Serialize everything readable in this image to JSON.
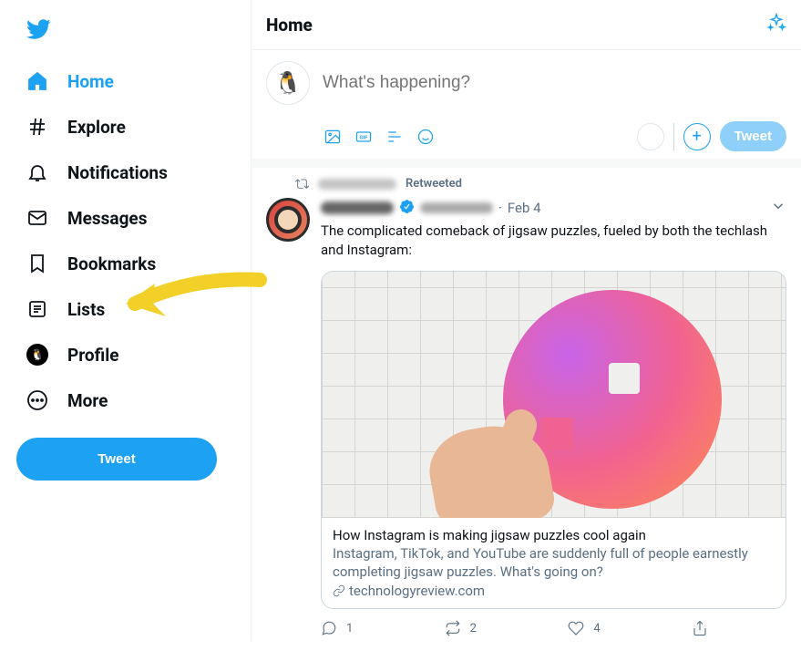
{
  "sidebar": {
    "items": [
      {
        "label": "Home",
        "active": true,
        "icon": "home"
      },
      {
        "label": "Explore",
        "active": false,
        "icon": "hash"
      },
      {
        "label": "Notifications",
        "active": false,
        "icon": "bell"
      },
      {
        "label": "Messages",
        "active": false,
        "icon": "mail"
      },
      {
        "label": "Bookmarks",
        "active": false,
        "icon": "bookmark"
      },
      {
        "label": "Lists",
        "active": false,
        "icon": "list"
      },
      {
        "label": "Profile",
        "active": false,
        "icon": "profile"
      },
      {
        "label": "More",
        "active": false,
        "icon": "more"
      }
    ],
    "tweet_button": "Tweet"
  },
  "header": {
    "title": "Home"
  },
  "compose": {
    "placeholder": "What's happening?",
    "tweet_label": "Tweet"
  },
  "retweet_line": {
    "action": "Retweeted"
  },
  "tweet": {
    "date": "Feb 4",
    "text": "The complicated comeback of jigsaw puzzles, fueled by both the techlash and Instagram:",
    "card": {
      "title": "How Instagram is making jigsaw puzzles cool again",
      "description": "Instagram, TikTok, and YouTube are suddenly full of people earnestly completing jigsaw puzzles. What's going on?",
      "domain": "technologyreview.com"
    },
    "reply_count": "1",
    "retweet_count": "2",
    "like_count": "4"
  }
}
